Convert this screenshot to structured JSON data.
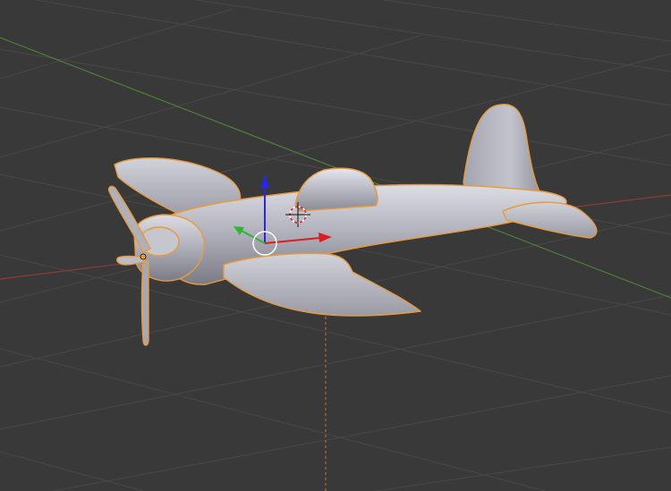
{
  "viewport": {
    "view": "3d-viewport",
    "background_color": "#393939",
    "grid_line_color": "#4a4a4a",
    "axis_x_color": "#8f3a3a",
    "axis_y_color": "#4f7f3a",
    "selection_outline_color": "#e89a3c"
  },
  "scene": {
    "object": {
      "name_icon": "airplane-mesh",
      "selected": true,
      "material_color": "#b3b3bd"
    },
    "manipulator": {
      "x_axis_color": "#d81f1f",
      "y_axis_color": "#2fb52f",
      "z_axis_color": "#2828e0",
      "center_ring_color": "#ffffff"
    },
    "cursor_3d": {
      "icon": "crosshair-icon"
    }
  }
}
